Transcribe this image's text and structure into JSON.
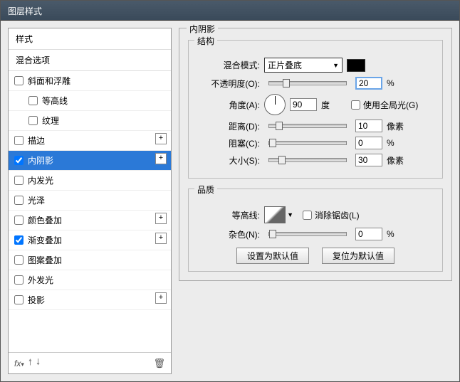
{
  "window": {
    "title": "图层样式"
  },
  "left": {
    "header_styles": "样式",
    "header_blend": "混合选项",
    "items": [
      {
        "label": "斜面和浮雕",
        "checked": false,
        "plus": false,
        "indent": false
      },
      {
        "label": "等高线",
        "checked": false,
        "plus": false,
        "indent": true
      },
      {
        "label": "纹理",
        "checked": false,
        "plus": false,
        "indent": true
      },
      {
        "label": "描边",
        "checked": false,
        "plus": true,
        "indent": false
      },
      {
        "label": "内阴影",
        "checked": true,
        "plus": true,
        "indent": false,
        "selected": true
      },
      {
        "label": "内发光",
        "checked": false,
        "plus": false,
        "indent": false
      },
      {
        "label": "光泽",
        "checked": false,
        "plus": false,
        "indent": false
      },
      {
        "label": "颜色叠加",
        "checked": false,
        "plus": true,
        "indent": false
      },
      {
        "label": "渐变叠加",
        "checked": true,
        "plus": true,
        "indent": false
      },
      {
        "label": "图案叠加",
        "checked": false,
        "plus": false,
        "indent": false
      },
      {
        "label": "外发光",
        "checked": false,
        "plus": false,
        "indent": false
      },
      {
        "label": "投影",
        "checked": false,
        "plus": true,
        "indent": false
      }
    ],
    "footer_fx": "fx"
  },
  "panel": {
    "title": "内阴影",
    "structure": {
      "title": "结构",
      "blend_mode_label": "混合模式:",
      "blend_mode_value": "正片叠底",
      "opacity_label": "不透明度(O):",
      "opacity_value": "20",
      "opacity_unit": "%",
      "angle_label": "角度(A):",
      "angle_value": "90",
      "angle_unit": "度",
      "global_light_label": "使用全局光(G)",
      "distance_label": "距离(D):",
      "distance_value": "10",
      "distance_unit": "像素",
      "choke_label": "阻塞(C):",
      "choke_value": "0",
      "choke_unit": "%",
      "size_label": "大小(S):",
      "size_value": "30",
      "size_unit": "像素"
    },
    "quality": {
      "title": "品质",
      "contour_label": "等高线:",
      "antialias_label": "消除锯齿(L)",
      "noise_label": "杂色(N):",
      "noise_value": "0",
      "noise_unit": "%"
    },
    "buttons": {
      "set_default": "设置为默认值",
      "reset_default": "复位为默认值"
    }
  }
}
